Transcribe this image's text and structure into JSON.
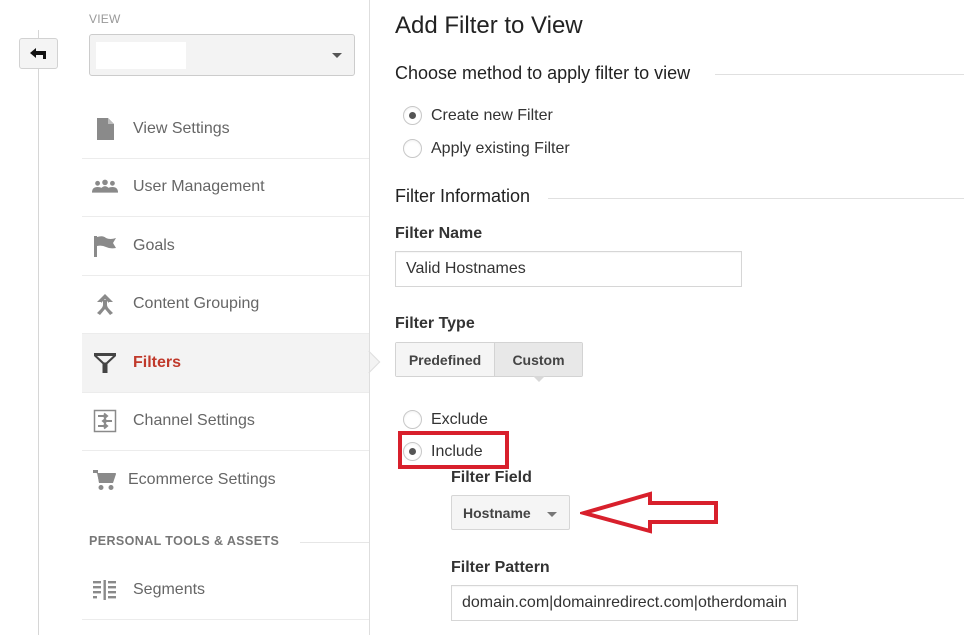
{
  "nav_rail": {
    "back_icon": "back-arrow-icon"
  },
  "sidebar": {
    "view_label": "VIEW",
    "view_select_value": "",
    "items": [
      {
        "label": "View Settings",
        "icon": "document-icon",
        "active": false
      },
      {
        "label": "User Management",
        "icon": "users-icon",
        "active": false
      },
      {
        "label": "Goals",
        "icon": "flag-icon",
        "active": false
      },
      {
        "label": "Content Grouping",
        "icon": "content-grouping-icon",
        "active": false
      },
      {
        "label": "Filters",
        "icon": "filter-icon",
        "active": true
      },
      {
        "label": "Channel Settings",
        "icon": "channel-settings-icon",
        "active": false
      },
      {
        "label": "Ecommerce Settings",
        "icon": "cart-icon",
        "active": false
      }
    ],
    "section_header": "PERSONAL TOOLS & ASSETS",
    "section_items": [
      {
        "label": "Segments",
        "icon": "segments-icon"
      }
    ]
  },
  "main": {
    "title": "Add Filter to View",
    "method_section": {
      "title": "Choose method to apply filter to view",
      "options": [
        {
          "label": "Create new Filter",
          "selected": true
        },
        {
          "label": "Apply existing Filter",
          "selected": false
        }
      ]
    },
    "info_section": {
      "title": "Filter Information",
      "filter_name_label": "Filter Name",
      "filter_name_value": "Valid Hostnames",
      "filter_type_label": "Filter Type",
      "filter_type_tabs": [
        {
          "label": "Predefined",
          "selected": false
        },
        {
          "label": "Custom",
          "selected": true
        }
      ],
      "custom_options": [
        {
          "label": "Exclude",
          "selected": false
        },
        {
          "label": "Include",
          "selected": true
        }
      ],
      "filter_field_label": "Filter Field",
      "filter_field_value": "Hostname",
      "filter_pattern_label": "Filter Pattern",
      "filter_pattern_value": "domain.com|domainredirect.com|otherdomain"
    }
  },
  "annotations": {
    "color": "#d8202c",
    "highlight_target": "Include",
    "arrow_target": "Hostname"
  },
  "colors": {
    "active_nav": "#c0392b"
  }
}
